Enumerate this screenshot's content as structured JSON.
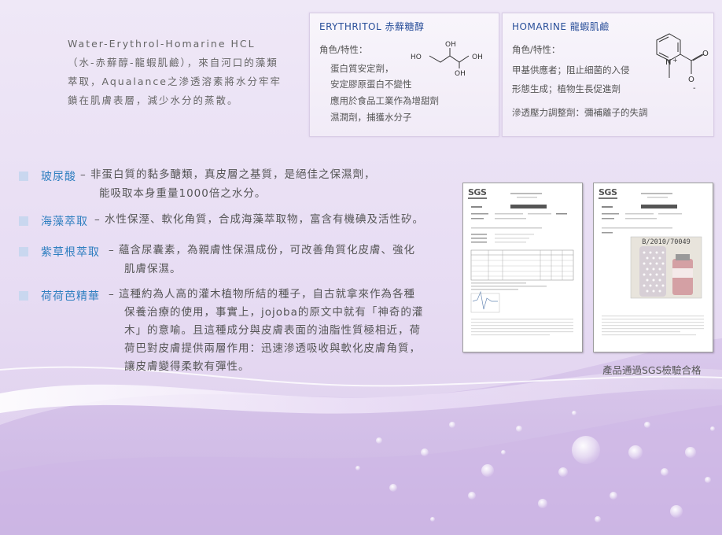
{
  "intro": {
    "lines": [
      "Water-Erythrol-Homarine HCL",
      "（水-赤蘚醇-龍蝦肌鹼），來自河口的藻類",
      "萃取，Aqualance之滲透溶素將水分牢牢",
      "鎖在肌膚表層，減少水分的蒸散。"
    ]
  },
  "erythritol_card": {
    "title": "ERYTHRITOL 赤蘚糖醇",
    "role_label": "角色/特性：",
    "lines": [
      "蛋白質安定劑，",
      "安定膠原蛋白不變性",
      "應用於食品工業作為增甜劑",
      "濕潤劑，捕獲水分子"
    ],
    "structure_labels": [
      "HO",
      "OH",
      "OH",
      "OH"
    ]
  },
  "homarine_card": {
    "title": "HOMARINE 龍蝦肌鹼",
    "role_label": "角色/特性：",
    "lines": [
      "甲基供應者；阻止細菌的入侵",
      "形態生成；植物生長促進劑",
      "滲透壓力調整劑：彌補離子的失調"
    ],
    "structure_labels": [
      "N",
      "+",
      "O",
      "O",
      "-"
    ]
  },
  "ingredients": [
    {
      "name": "玻尿酸",
      "desc": [
        "– 非蛋白質的黏多醣類，真皮層之基質，是絕佳之保濕劑，",
        "能吸取本身重量1000倍之水分。"
      ]
    },
    {
      "name": "海藻萃取",
      "desc": [
        "– 水性保溼、軟化角質，合成海藻萃取物，富含有機碘及活性矽。"
      ]
    },
    {
      "name": "紫草根萃取",
      "desc": [
        "– 蘊含尿囊素，為親膚性保濕成份，可改善角質化皮膚、強化",
        "肌膚保濕。"
      ]
    },
    {
      "name": "荷荷芭精華",
      "desc": [
        "– 這種約為人高的灌木植物所結的種子，自古就拿來作為各種",
        "保養治療的使用，事實上，jojoba的原文中就有「神奇的灌",
        "木」的意喻。且這種成分與皮膚表面的油脂性質極相近，荷",
        "荷巴對皮膚提供兩層作用：迅速滲透吸收與軟化皮膚角質，",
        "讓皮膚變得柔軟有彈性。"
      ]
    }
  ],
  "certificates": {
    "logo": "SGS",
    "photo_label": "B/2010/70049",
    "caption": "產品通過SGS檢驗合格"
  },
  "colors": {
    "accent_blue": "#2f7fc0",
    "title_blue": "#2a4f9a",
    "bullet": "#c9d7ef",
    "background": "#e7dcf3"
  }
}
